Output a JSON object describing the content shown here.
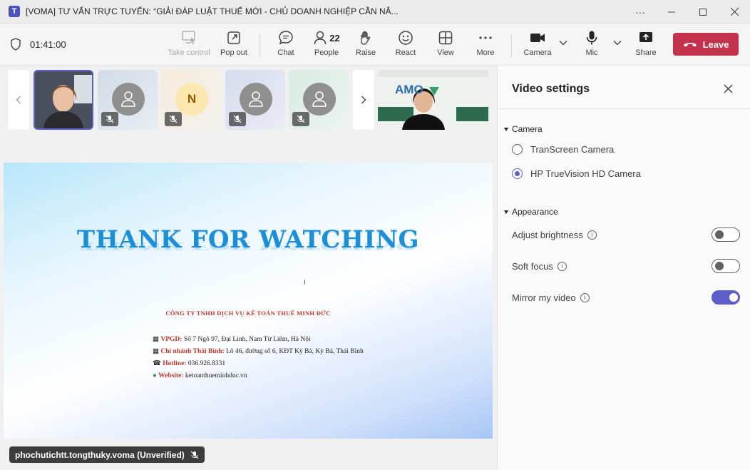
{
  "window": {
    "app_icon_letter": "T",
    "title": "[VOMA] TƯ VẤN TRỰC TUYẾN: “GIẢI ĐÁP LUẬT THUẾ MỚI - CHỦ DOANH NGHIỆP CẦN NẮ...",
    "more_label": "···"
  },
  "toolbar": {
    "timer": "01:41:00",
    "take_control": "Take control",
    "pop_out": "Pop out",
    "chat": "Chat",
    "people": "People",
    "people_count": "22",
    "raise": "Raise",
    "react": "React",
    "view": "View",
    "more": "More",
    "camera": "Camera",
    "mic": "Mic",
    "share": "Share",
    "leave": "Leave"
  },
  "participants": {
    "initial_tile_letter": "N"
  },
  "slide": {
    "title": "THANK FOR WATCHING",
    "company": "CÔNG TY TNHH DỊCH VỤ KẾ TOÁN THUẾ MINH ĐỨC",
    "vpgd_key": "VPGD:",
    "vpgd_val": "Số 7 Ngõ 97, Đại Linh, Nam Từ Liêm, Hà Nội",
    "branch_key": "Chi nhánh Thái Bình:",
    "branch_val": "Lô 46, đường số 6, KĐT Kỳ Bá, Kỳ Bá, Thái Bình",
    "hotline_key": "Hotline:",
    "hotline_val": "036.926.8331",
    "website_key": "Website:",
    "website_val": "ketoanthueminhduc.vn",
    "cursor": "I"
  },
  "presenter": {
    "name_tag": "phochutichtt.tongthuky.voma (Unverified)",
    "logo_text": "AMO"
  },
  "panel": {
    "title": "Video settings",
    "camera_section": "Camera",
    "camera_options": [
      "TranScreen Camera",
      "HP TrueVision HD Camera"
    ],
    "appearance_section": "Appearance",
    "adjust_brightness": "Adjust brightness",
    "soft_focus": "Soft focus",
    "mirror_video": "Mirror my video",
    "info_glyph": "i"
  },
  "colors": {
    "accent": "#5b5fc7",
    "leave": "#c4314b"
  }
}
